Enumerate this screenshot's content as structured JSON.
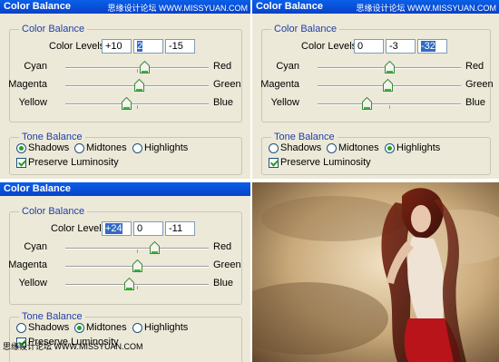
{
  "panels": [
    {
      "title": "Color Balance",
      "watermark": "思缘设计论坛 WWW.MISSYUAN.COM",
      "color_balance_label": "Color Balance",
      "color_levels_label": "Color Levels:",
      "levels": [
        "+10",
        "2",
        "-15"
      ],
      "selected_level": 1,
      "sliders": [
        {
          "left": "Cyan",
          "right": "Red",
          "value": 10
        },
        {
          "left": "Magenta",
          "right": "Green",
          "value": 2
        },
        {
          "left": "Yellow",
          "right": "Blue",
          "value": -15
        }
      ],
      "tone_balance_label": "Tone Balance",
      "tones": [
        "Shadows",
        "Midtones",
        "Highlights"
      ],
      "selected_tone": "Shadows",
      "preserve_label": "Preserve Luminosity",
      "preserve_checked": true
    },
    {
      "title": "Color Balance",
      "watermark": "思缘设计论坛 WWW.MISSYUAN.COM",
      "color_balance_label": "Color Balance",
      "color_levels_label": "Color Levels:",
      "levels": [
        "0",
        "-3",
        "-32"
      ],
      "selected_level": 2,
      "sliders": [
        {
          "left": "Cyan",
          "right": "Red",
          "value": 0
        },
        {
          "left": "Magenta",
          "right": "Green",
          "value": -3
        },
        {
          "left": "Yellow",
          "right": "Blue",
          "value": -32
        }
      ],
      "tone_balance_label": "Tone Balance",
      "tones": [
        "Shadows",
        "Midtones",
        "Highlights"
      ],
      "selected_tone": "Highlights",
      "preserve_label": "Preserve Luminosity",
      "preserve_checked": true
    },
    {
      "title": "Color Balance",
      "watermark": "",
      "color_balance_label": "Color Balance",
      "color_levels_label": "Color Levels:",
      "levels": [
        "+24",
        "0",
        "-11"
      ],
      "selected_level": 0,
      "sliders": [
        {
          "left": "Cyan",
          "right": "Red",
          "value": 24
        },
        {
          "left": "Magenta",
          "right": "Green",
          "value": 0
        },
        {
          "left": "Yellow",
          "right": "Blue",
          "value": -11
        }
      ],
      "tone_balance_label": "Tone Balance",
      "tones": [
        "Shadows",
        "Midtones",
        "Highlights"
      ],
      "selected_tone": "Midtones",
      "preserve_label": "Preserve Luminosity",
      "preserve_checked": true
    }
  ],
  "footer_watermark": "思缘设计论坛 WWW.MISSYUAN.COM",
  "colors": {
    "titlebar": "#0842c8",
    "dialog_bg": "#ece9d8",
    "group_label": "#1f3fa8",
    "selection": "#316ac5",
    "check_green": "#21a121"
  },
  "icons": {
    "slider_thumb": "triangle-slider-thumb-icon",
    "radio": "radio-icon",
    "checkbox": "checkbox-icon"
  }
}
